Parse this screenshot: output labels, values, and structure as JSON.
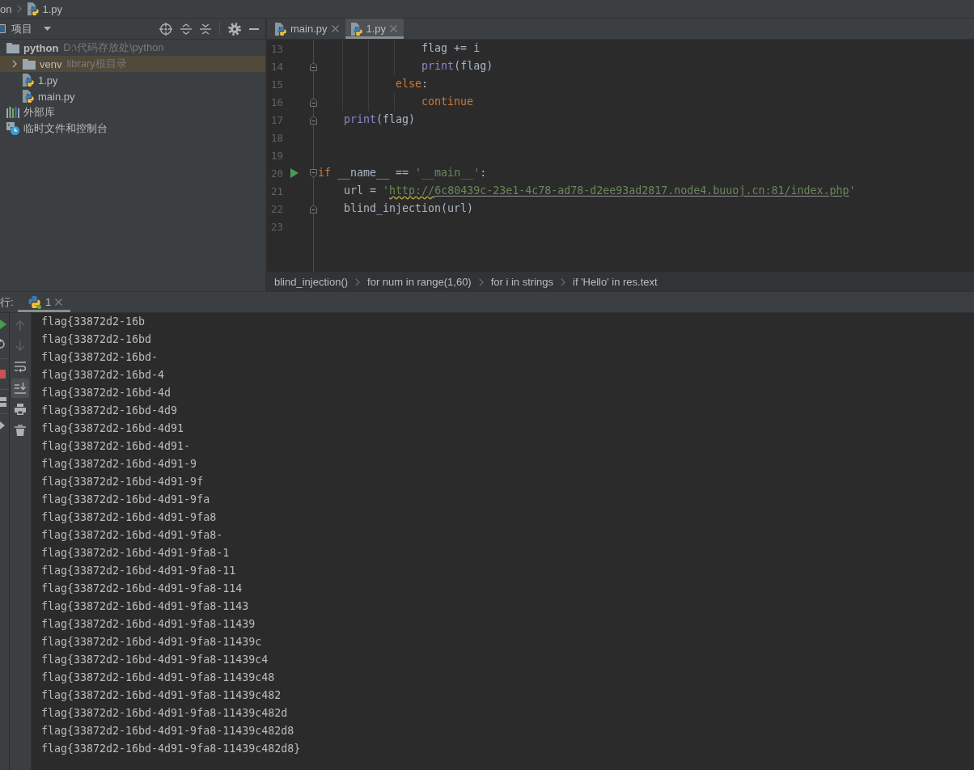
{
  "navigation_bar": {
    "project": "on",
    "file": "1.py"
  },
  "project_panel": {
    "title": "项目",
    "tree": [
      {
        "label": "python",
        "hint": "D:\\代码存放处\\python",
        "kind": "folder",
        "selected": false,
        "children": [
          {
            "label": "venv",
            "hint": "library根目录",
            "kind": "folder",
            "expanded": false,
            "selected": true
          },
          {
            "label": "1.py",
            "kind": "python-file",
            "selected": false
          },
          {
            "label": "main.py",
            "kind": "python-file",
            "selected": false
          }
        ]
      },
      {
        "label": "外部库",
        "kind": "library",
        "selected": false
      },
      {
        "label": "临时文件和控制台",
        "kind": "scratches",
        "selected": false
      }
    ]
  },
  "editor": {
    "tabs": [
      {
        "label": "main.py",
        "selected": false
      },
      {
        "label": "1.py",
        "selected": true
      }
    ],
    "lines": [
      {
        "number": "13",
        "tokens": [
          {
            "kind": "plain",
            "text": "                flag += i"
          }
        ]
      },
      {
        "number": "14",
        "fold_end": true,
        "tokens": [
          {
            "kind": "builtin",
            "text": "                print"
          },
          {
            "kind": "plain",
            "text": "(flag)"
          }
        ]
      },
      {
        "number": "15",
        "tokens": [
          {
            "kind": "keyword",
            "text": "            else"
          },
          {
            "kind": "plain",
            "text": ":"
          }
        ]
      },
      {
        "number": "16",
        "fold_end": true,
        "tokens": [
          {
            "kind": "keyword",
            "text": "                continue"
          }
        ]
      },
      {
        "number": "17",
        "fold_end": true,
        "tokens": [
          {
            "kind": "builtin",
            "text": "    print"
          },
          {
            "kind": "plain",
            "text": "(flag)"
          }
        ]
      },
      {
        "number": "18"
      },
      {
        "number": "19"
      },
      {
        "number": "20",
        "run_marker": true,
        "fold_start": true,
        "tokens": [
          {
            "kind": "keyword",
            "text": "if"
          },
          {
            "kind": "plain",
            "text": " __name__ == "
          },
          {
            "kind": "string",
            "text": "'__main__'"
          },
          {
            "kind": "plain",
            "text": ":"
          }
        ]
      },
      {
        "number": "21",
        "tokens": [
          {
            "kind": "plain",
            "text": "    url = "
          },
          {
            "kind": "string",
            "text": "'"
          },
          {
            "kind": "link",
            "text": "http://",
            "typo": true
          },
          {
            "kind": "link",
            "text": "6c80439c-23e1-4c78-ad78-d2ee93ad2817.node4.buuoj.cn:81/index.php"
          },
          {
            "kind": "string",
            "text": "'"
          }
        ]
      },
      {
        "number": "22",
        "fold_end": true,
        "tokens": [
          {
            "kind": "plain",
            "text": "    blind_injection(url)"
          }
        ]
      },
      {
        "number": "23"
      }
    ],
    "breadcrumbs": [
      "blind_injection()",
      "for num in range(1,60)",
      "for i in strings",
      "if 'Hello' in res.text"
    ]
  },
  "run_panel": {
    "label": "行:",
    "tabs": [
      {
        "label": "1",
        "selected": true,
        "running": true
      }
    ],
    "toolbar": [
      {
        "disabled": true,
        "on": false
      },
      {
        "disabled": true,
        "on": false
      },
      {
        "disabled": false,
        "on": false
      },
      {
        "disabled": false,
        "on": true
      },
      {
        "disabled": false,
        "on": false
      },
      {
        "disabled": false,
        "on": false
      }
    ],
    "output": [
      "flag{33872d2-16b",
      "flag{33872d2-16bd",
      "flag{33872d2-16bd-",
      "flag{33872d2-16bd-4",
      "flag{33872d2-16bd-4d",
      "flag{33872d2-16bd-4d9",
      "flag{33872d2-16bd-4d91",
      "flag{33872d2-16bd-4d91-",
      "flag{33872d2-16bd-4d91-9",
      "flag{33872d2-16bd-4d91-9f",
      "flag{33872d2-16bd-4d91-9fa",
      "flag{33872d2-16bd-4d91-9fa8",
      "flag{33872d2-16bd-4d91-9fa8-",
      "flag{33872d2-16bd-4d91-9fa8-1",
      "flag{33872d2-16bd-4d91-9fa8-11",
      "flag{33872d2-16bd-4d91-9fa8-114",
      "flag{33872d2-16bd-4d91-9fa8-1143",
      "flag{33872d2-16bd-4d91-9fa8-11439",
      "flag{33872d2-16bd-4d91-9fa8-11439c",
      "flag{33872d2-16bd-4d91-9fa8-11439c4",
      "flag{33872d2-16bd-4d91-9fa8-11439c48",
      "flag{33872d2-16bd-4d91-9fa8-11439c482",
      "flag{33872d2-16bd-4d91-9fa8-11439c482d",
      "flag{33872d2-16bd-4d91-9fa8-11439c482d8",
      "flag{33872d2-16bd-4d91-9fa8-11439c482d8}"
    ]
  }
}
